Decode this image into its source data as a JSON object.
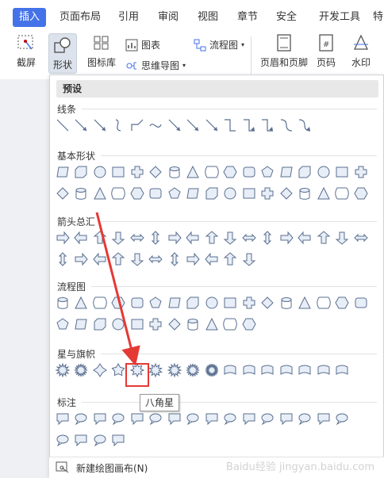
{
  "tabs": [
    "插入",
    "页面布局",
    "引用",
    "审阅",
    "视图",
    "章节",
    "安全",
    "开发工具",
    "特"
  ],
  "toolbar": {
    "screenshot": "截屏",
    "shapes": "形状",
    "iconlib": "图标库",
    "chart": "图表",
    "mindmap": "思维导图",
    "flowchart": "流程图",
    "header_footer": "页眉和页脚",
    "pagenum": "页码",
    "watermark": "水印"
  },
  "panel": {
    "header": "预设",
    "sections": [
      "线条",
      "基本形状",
      "箭头总汇",
      "流程图",
      "星与旗帜",
      "标注"
    ],
    "footer": "新建绘图画布(N)"
  },
  "tooltip": "八角星",
  "watermark": "Baidu经验 jingyan.baidu.com"
}
